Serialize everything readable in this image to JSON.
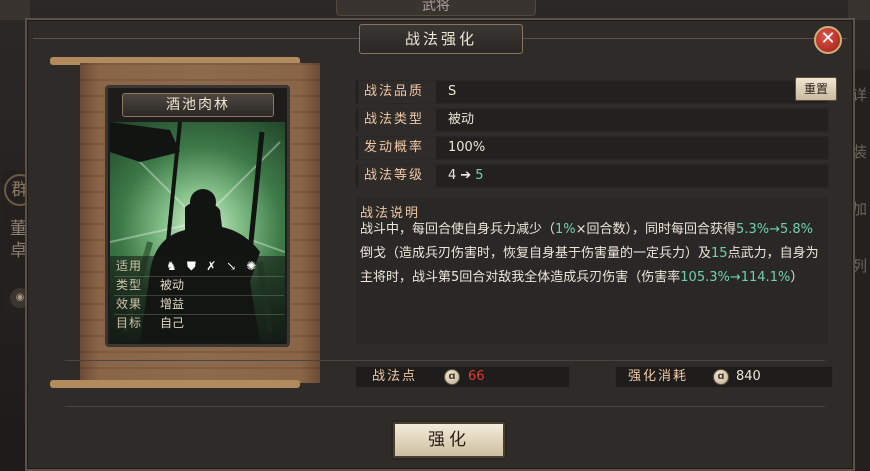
{
  "background": {
    "top_tab": "武将",
    "left_seal": "群",
    "left_name": "董卓",
    "right_strip": [
      "详",
      "装",
      "加",
      "列"
    ]
  },
  "dialog": {
    "title": "战法强化",
    "close_icon": "close-icon"
  },
  "card": {
    "name": "酒池肉林",
    "attrs": [
      {
        "key": "适用",
        "value": ""
      },
      {
        "key": "类型",
        "value": "被动"
      },
      {
        "key": "效果",
        "value": "增益"
      },
      {
        "key": "目标",
        "value": "自己"
      }
    ],
    "weapon_icons": [
      "cavalry-icon",
      "shield-icon",
      "bow-icon",
      "spear-icon",
      "wheel-icon"
    ]
  },
  "info": {
    "quality_label": "战法品质",
    "quality_value": "S",
    "type_label": "战法类型",
    "type_value": "被动",
    "chance_label": "发动概率",
    "chance_value": "100%",
    "level_label": "战法等级",
    "level_from": "4",
    "level_to": "5",
    "reset_label": "重置"
  },
  "description": {
    "title": "战法说明",
    "segments": [
      {
        "text": "战斗中，每回合使自身兵力减少（",
        "green": false
      },
      {
        "text": "1%",
        "green": true
      },
      {
        "text": "×回合数），同时每回合获得",
        "green": false
      },
      {
        "text": "5.3%→5.8%",
        "green": true
      },
      {
        "text": "倒戈（造成兵刃伤害时，恢复自身基于伤害量的一定兵力）及",
        "green": false
      },
      {
        "text": "15",
        "green": true
      },
      {
        "text": "点武力，自身为主将时，战斗第5回合对敌我全体造成兵刃伤害（伤害率",
        "green": false
      },
      {
        "text": "105.3%→114.1%",
        "green": true
      },
      {
        "text": "）",
        "green": false
      }
    ]
  },
  "stats": {
    "points_label": "战法点",
    "points_value": "66",
    "cost_label": "强化消耗",
    "cost_value": "840",
    "points_color": "#e23b2e",
    "cost_color": "#ebe5d8"
  },
  "enhance_label": "强化",
  "colors": {
    "label": "#f0c8a6",
    "highlight": "#6fd2ae",
    "danger": "#e23b2e"
  }
}
